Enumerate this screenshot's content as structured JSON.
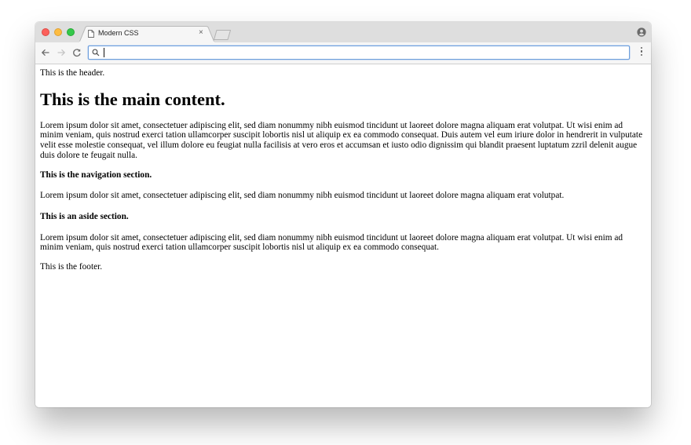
{
  "browser": {
    "tab_title": "Modern CSS",
    "tab_close": "×",
    "address_value": "",
    "icons": {
      "back": "arrow-left-icon",
      "forward": "arrow-right-icon",
      "reload": "reload-icon",
      "search": "search-icon",
      "menu": "menu-dots-icon",
      "profile": "profile-icon",
      "page": "page-icon"
    },
    "colors": {
      "close": "#fc605b",
      "minimize": "#fdbc40",
      "maximize": "#34c84a",
      "focus_ring": "#6e9fdc"
    }
  },
  "page": {
    "header": "This is the header.",
    "main_title": "This is the main content.",
    "main_paragraph": "Lorem ipsum dolor sit amet, consectetuer adipiscing elit, sed diam nonummy nibh euismod tincidunt ut laoreet dolore magna aliquam erat volutpat. Ut wisi enim ad minim veniam, quis nostrud exerci tation ullamcorper suscipit lobortis nisl ut aliquip ex ea commodo consequat. Duis autem vel eum iriure dolor in hendrerit in vulputate velit esse molestie consequat, vel illum dolore eu feugiat nulla facilisis at vero eros et accumsan et iusto odio dignissim qui blandit praesent luptatum zzril delenit augue duis dolore te feugait nulla.",
    "nav_heading": "This is the navigation section.",
    "nav_paragraph": "Lorem ipsum dolor sit amet, consectetuer adipiscing elit, sed diam nonummy nibh euismod tincidunt ut laoreet dolore magna aliquam erat volutpat.",
    "aside_heading": "This is an aside section.",
    "aside_paragraph": "Lorem ipsum dolor sit amet, consectetuer adipiscing elit, sed diam nonummy nibh euismod tincidunt ut laoreet dolore magna aliquam erat volutpat. Ut wisi enim ad minim veniam, quis nostrud exerci tation ullamcorper suscipit lobortis nisl ut aliquip ex ea commodo consequat.",
    "footer": "This is the footer."
  }
}
